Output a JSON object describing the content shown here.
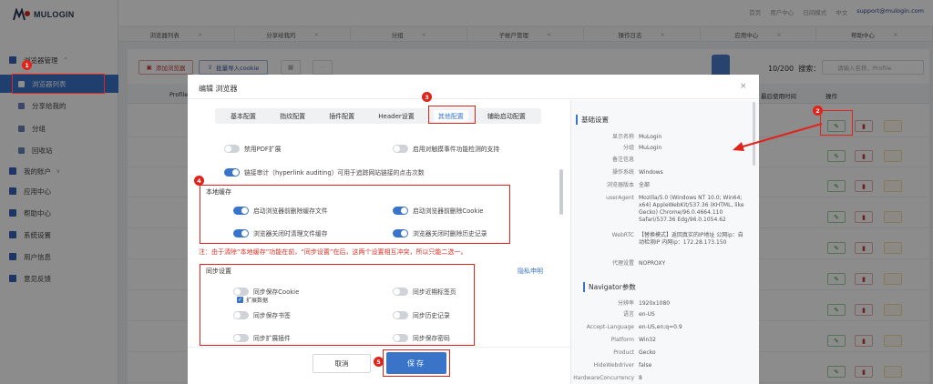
{
  "app": {
    "logo_text": "MULOGIN",
    "top_links": [
      "首页",
      "用户中心",
      "日间模式",
      "中文"
    ],
    "email": "support@mulogin.com"
  },
  "sidebar": {
    "items": [
      {
        "label": "浏览器管理",
        "chevron": "^"
      },
      {
        "label": "浏览器列表"
      },
      {
        "label": "分享给我的"
      },
      {
        "label": "分组"
      },
      {
        "label": "回收站"
      },
      {
        "label": "我的账户",
        "chevron": "v"
      },
      {
        "label": "应用中心"
      },
      {
        "label": "帮助中心"
      },
      {
        "label": "系统设置"
      },
      {
        "label": "用户信息"
      },
      {
        "label": "意见反馈"
      }
    ]
  },
  "tabbar": {
    "tabs": [
      "浏览器列表",
      "分享给我的",
      "分组",
      "子帐户管理",
      "操作日志",
      "应用中心",
      "帮助中心"
    ]
  },
  "toolbar": {
    "add_label": "添加浏览器",
    "import_label": "批量导入cookie",
    "more": "···",
    "count": "10/200",
    "search_label": "搜索：",
    "search_placeholder": "请输入名称、Profile"
  },
  "table": {
    "col_profile": "Profile",
    "col_last_used": "最后使用时间",
    "col_ops": "操作"
  },
  "modal": {
    "title": "编辑 浏览器",
    "close": "×",
    "tabs": [
      "基本配置",
      "指纹配置",
      "插件配置",
      "Header设置",
      "其他配置",
      "辅助启动配置"
    ],
    "active_tab": "其他配置",
    "top_options": [
      {
        "label": "禁用PDF扩展",
        "on": false
      },
      {
        "label": "启用对触摸事件功能检测的支持",
        "on": false
      },
      {
        "label": "链接审计（hyperlink auditing）可用于追踪网站链接的点击次数",
        "on": true
      }
    ],
    "local_cache": {
      "title": "本地缓存",
      "options": [
        {
          "label": "启动浏览器前删除缓存文件",
          "on": true
        },
        {
          "label": "启动浏览器前删除Cookie",
          "on": true
        },
        {
          "label": "浏览器关闭时清理文件缓存",
          "on": true
        },
        {
          "label": "浏览器关闭时删除历史记录",
          "on": true
        }
      ]
    },
    "warning": "注：由于清除“本地缓存”功能在前，“同步设置”在后，这两个设置相互冲突，所以只能二选一。",
    "sync": {
      "title": "同步设置",
      "privacy_link": "隐私申明",
      "options": [
        {
          "label": "同步保存Cookie",
          "on": false
        },
        {
          "label": "同步近期标签页",
          "on": false
        },
        {
          "label": "同步保存书签",
          "on": false
        },
        {
          "label": "同步历史记录",
          "on": false
        },
        {
          "label": "同步扩展插件",
          "on": false
        },
        {
          "label": "同步保存密码",
          "on": false
        }
      ],
      "sub_check": "扩展数据"
    },
    "cancel_label": "取消",
    "save_label": "保存"
  },
  "info_panel": {
    "basic_title": "基础设置",
    "basic": [
      {
        "k": "显示名称",
        "v": "MuLogin"
      },
      {
        "k": "分组",
        "v": "MuLogin"
      },
      {
        "k": "备注信息",
        "v": ""
      },
      {
        "k": "操作系统",
        "v": "Windows"
      },
      {
        "k": "浏览器版本",
        "v": "全部"
      },
      {
        "k": "userAgent",
        "v": "Mozilla/5.0 (Windows NT 10.0; Win64; x64) AppleWebKit/537.36 (KHTML, like Gecko) Chrome/96.0.4664.110 Safari/537.36 Edg/96.0.1054.62"
      },
      {
        "k": "WebRTC",
        "v": "【替换模式】返回真实的IP地址 公网ip：自动检测IP 内网ip：172.28.173.150"
      },
      {
        "k": "代理设置",
        "v": "NOPROXY"
      }
    ],
    "nav_title": "Navigator参数",
    "nav": [
      {
        "k": "分辨率",
        "v": "1920x1080"
      },
      {
        "k": "语言",
        "v": "en-US"
      },
      {
        "k": "Accept-Language",
        "v": "en-US,en;q=0.9"
      },
      {
        "k": "Platform",
        "v": "Win32"
      },
      {
        "k": "Product",
        "v": "Gecko"
      },
      {
        "k": "HideWebdriver",
        "v": "false"
      },
      {
        "k": "HardwareConcurrency",
        "v": "8"
      }
    ]
  },
  "annotations": [
    "1",
    "2",
    "3",
    "4",
    "5"
  ]
}
